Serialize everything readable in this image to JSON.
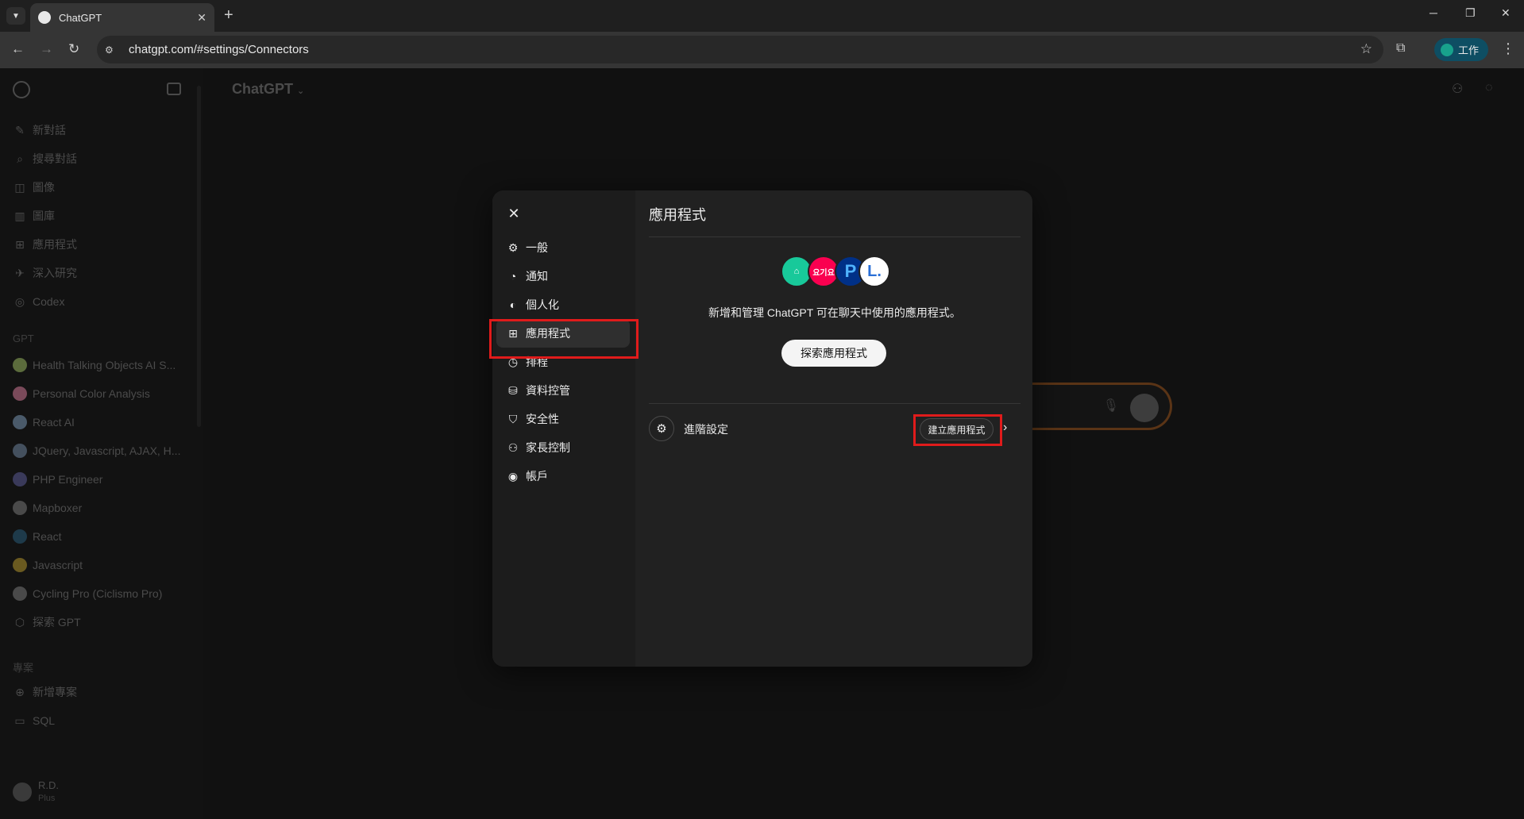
{
  "browser": {
    "tab_title": "ChatGPT",
    "url": "chatgpt.com/#settings/Connectors",
    "profile_label": "工作"
  },
  "sidebar": {
    "items": [
      {
        "label": "新對話",
        "icon": "edit-icon"
      },
      {
        "label": "搜尋對話",
        "icon": "search-icon"
      },
      {
        "label": "圖像",
        "icon": "image-icon"
      },
      {
        "label": "圖庫",
        "icon": "library-icon"
      },
      {
        "label": "應用程式",
        "icon": "apps-icon"
      },
      {
        "label": "深入研究",
        "icon": "telescope-icon"
      },
      {
        "label": "Codex",
        "icon": "codex-icon"
      }
    ],
    "gpt_section_label": "GPT",
    "gpts": [
      {
        "label": "Health Talking Objects AI S...",
        "color": "#5b6b3c"
      },
      {
        "label": "Personal Color Analysis",
        "color": "#7a4a5a"
      },
      {
        "label": "React AI",
        "color": "#4a5a6a"
      },
      {
        "label": "JQuery, Javascript, AJAX, H...",
        "color": "#44505e"
      },
      {
        "label": "PHP Engineer",
        "color": "#3a3a5a"
      },
      {
        "label": "Mapboxer",
        "color": "#4a4a4a"
      },
      {
        "label": "React",
        "color": "#1e3a4a"
      },
      {
        "label": "Javascript",
        "color": "#6a5a20"
      },
      {
        "label": "Cycling Pro (Ciclismo Pro)",
        "color": "#4a4a4a"
      }
    ],
    "explore_gpt": "探索 GPT",
    "projects_section_label": "專案",
    "projects": [
      {
        "label": "新增專案",
        "icon": "new-folder-icon"
      },
      {
        "label": "SQL",
        "icon": "folder-icon"
      }
    ],
    "user": {
      "name": "R.D.",
      "plan": "Plus"
    }
  },
  "main": {
    "title": "ChatGPT"
  },
  "settings_modal": {
    "nav": [
      {
        "label": "一般",
        "icon": "gear-icon"
      },
      {
        "label": "通知",
        "icon": "bell-icon"
      },
      {
        "label": "個人化",
        "icon": "personalize-icon"
      },
      {
        "label": "應用程式",
        "icon": "apps-icon"
      },
      {
        "label": "排程",
        "icon": "clock-icon"
      },
      {
        "label": "資料控管",
        "icon": "database-icon"
      },
      {
        "label": "安全性",
        "icon": "shield-icon"
      },
      {
        "label": "家長控制",
        "icon": "parent-icon"
      },
      {
        "label": "帳戶",
        "icon": "account-icon"
      }
    ],
    "active_nav": "應用程式",
    "content_title": "應用程式",
    "description": "新增和管理 ChatGPT 可在聊天中使用的應用程式。",
    "explore_button": "探索應用程式",
    "advanced_label": "進階設定",
    "create_button": "建立應用程式",
    "app_logos": [
      {
        "text": "",
        "bg": "#18c99a"
      },
      {
        "text": "요기요",
        "bg": "#fa0050"
      },
      {
        "text": "P",
        "bg": "#003087"
      },
      {
        "text": "L.",
        "bg": "#ffffff"
      }
    ]
  },
  "colors": {
    "highlight": "#e01b1b",
    "modal_bg": "#212121"
  }
}
